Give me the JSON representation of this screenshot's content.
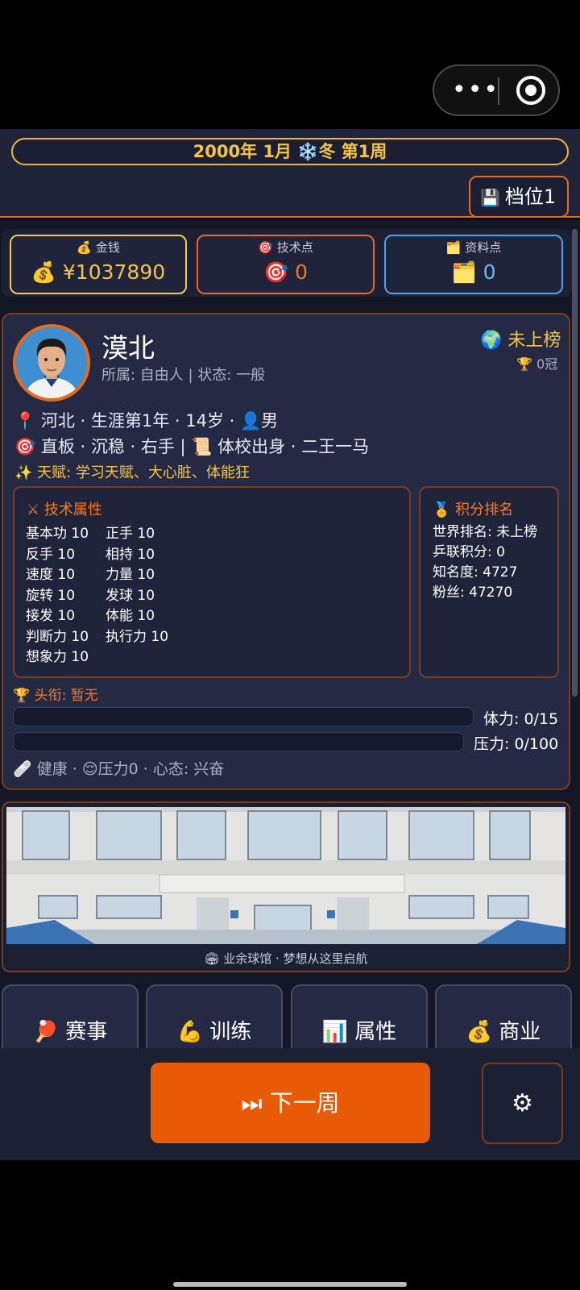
{
  "system": {
    "more_icon": "•••",
    "target_icon": "target-icon"
  },
  "header": {
    "date": "2000年 1月 ❄️冬 第1周",
    "save_icon": "💾",
    "save_label": "档位1"
  },
  "resources": [
    {
      "label": "💰 金钱",
      "value": "💰 ¥1037890",
      "color": "#f6c441"
    },
    {
      "label": "🎯 技术点",
      "value": "🎯 0",
      "color": "#f07a2a"
    },
    {
      "label": "🗂️ 资料点",
      "value": "🗂️ 0",
      "color": "#6cb7f7"
    }
  ],
  "player": {
    "name": "漠北",
    "status": "所属: 自由人 | 状态: 一般",
    "rank_badge": "🌍 未上榜",
    "crowns": "🏆 0冠",
    "info1": "📍 河北 · 生涯第1年 · 14岁 · 👤男",
    "info2": "🎯 直板 · 沉稳 · 右手 | 📜 体校出身 · 二王一马",
    "talent": "✨ 天赋: 学习天赋、大心脏、体能狂"
  },
  "skills": {
    "title": "⚔ 技术属性",
    "rows": [
      [
        "基本功 10",
        "正手 10"
      ],
      [
        "反手 10",
        "相持 10"
      ],
      [
        "速度 10",
        "力量 10"
      ],
      [
        "旋转 10",
        "发球 10"
      ],
      [
        "接发 10",
        "体能 10"
      ],
      [
        "判断力 10",
        "执行力 10"
      ],
      [
        "想象力 10",
        ""
      ]
    ]
  },
  "ranking": {
    "title": "🏅 积分排名",
    "world": "世界排名: 未上榜",
    "points": "乒联积分: 0",
    "fame": "知名度: 4727",
    "fans": "粉丝: 47270"
  },
  "honor": "🏆 头衔: 暂无",
  "stamina": {
    "label": "体力: 0/15",
    "fraction": 0
  },
  "pressure": {
    "label": "压力: 0/100",
    "fraction": 0
  },
  "health": "🩹 健康 · 😌压力0 · 心态: 兴奋",
  "venue": {
    "caption": "🏟 业余球馆 · 梦想从这里启航"
  },
  "tabs": [
    "🏓 赛事",
    "💪 训练",
    "📊 属性",
    "💰 商业"
  ],
  "actions": {
    "next_week": "⏭ 下一周",
    "settings": "⚙"
  }
}
